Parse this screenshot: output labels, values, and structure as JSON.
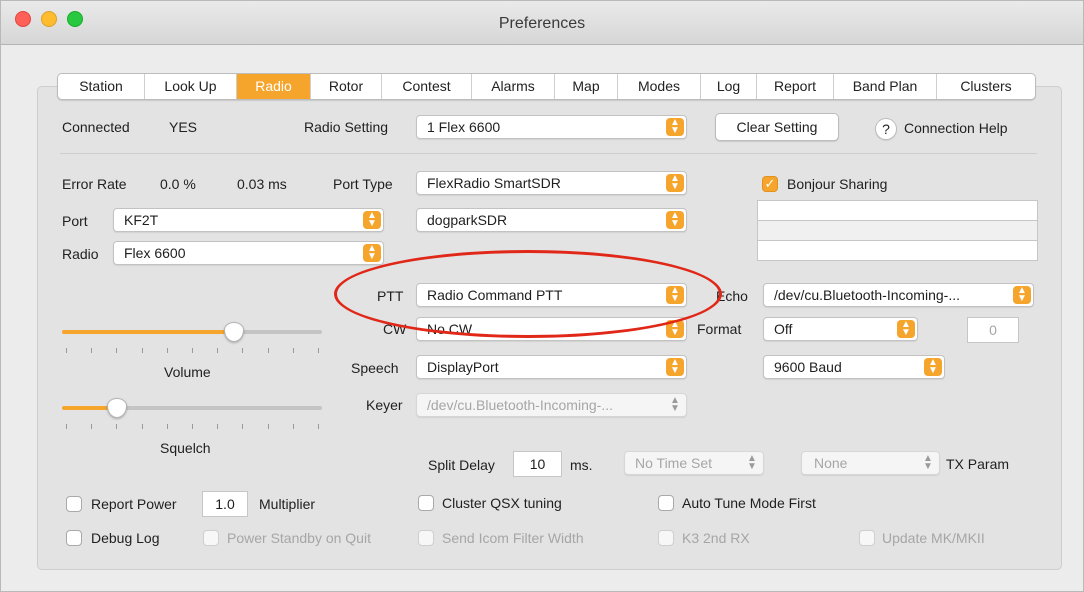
{
  "window": {
    "title": "Preferences"
  },
  "tabs": [
    {
      "label": "Station",
      "w": 87
    },
    {
      "label": "Look Up",
      "w": 92
    },
    {
      "label": "Radio",
      "w": 74,
      "active": true
    },
    {
      "label": "Rotor",
      "w": 71
    },
    {
      "label": "Contest",
      "w": 90
    },
    {
      "label": "Alarms",
      "w": 83
    },
    {
      "label": "Map",
      "w": 63
    },
    {
      "label": "Modes",
      "w": 83
    },
    {
      "label": "Log",
      "w": 56
    },
    {
      "label": "Report",
      "w": 77
    },
    {
      "label": "Band Plan",
      "w": 103
    },
    {
      "label": "Clusters",
      "w": 98
    }
  ],
  "status": {
    "connected_label": "Connected",
    "connected_value": "YES",
    "radio_setting_label": "Radio Setting",
    "radio_setting_value": "1 Flex 6600",
    "clear_setting": "Clear Setting",
    "help_icon": "?",
    "connection_help": "Connection Help"
  },
  "stats": {
    "error_rate_label": "Error Rate",
    "error_rate_value": "0.0 %",
    "latency": "0.03 ms"
  },
  "port_type": {
    "label": "Port Type",
    "value": "FlexRadio SmartSDR",
    "second_value": "dogparkSDR"
  },
  "port": {
    "label": "Port",
    "value": "KF2T"
  },
  "radio": {
    "label": "Radio",
    "value": "Flex 6600"
  },
  "bonjour": {
    "label": "Bonjour Sharing",
    "checked": true
  },
  "ptt": {
    "label": "PTT",
    "value": "Radio Command PTT"
  },
  "cw": {
    "label": "CW",
    "value": "No CW"
  },
  "speech": {
    "label": "Speech",
    "value": "DisplayPort"
  },
  "keyer": {
    "label": "Keyer",
    "value": "/dev/cu.Bluetooth-Incoming-..."
  },
  "echo": {
    "label": "Echo",
    "value": "/dev/cu.Bluetooth-Incoming-..."
  },
  "format": {
    "label": "Format",
    "value": "Off",
    "number": "0",
    "baud": "9600 Baud"
  },
  "sliders": {
    "volume_label": "Volume",
    "volume_level": 0.66,
    "squelch_label": "Squelch",
    "squelch_level": 0.21
  },
  "split": {
    "label": "Split Delay",
    "value": "10",
    "unit": "ms."
  },
  "time_set": {
    "value": "No Time Set"
  },
  "tx_param": {
    "value": "None",
    "label": "TX Param"
  },
  "options": {
    "report_power": "Report Power",
    "multiplier_value": "1.0",
    "multiplier_label": "Multiplier",
    "cluster_qsx": "Cluster QSX tuning",
    "auto_tune": "Auto Tune Mode First",
    "debug_log": "Debug Log",
    "power_standby": "Power Standby on Quit",
    "send_icom": "Send Icom Filter Width",
    "k3_2nd_rx": "K3 2nd RX",
    "update_mk": "Update MK/MKII"
  },
  "colors": {
    "accent": "#f6a52c",
    "annotation": "#e02718"
  }
}
